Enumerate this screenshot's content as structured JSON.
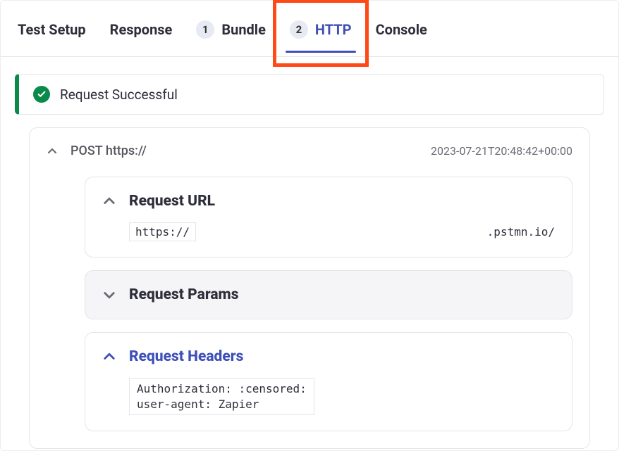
{
  "tabs": {
    "test_setup": "Test Setup",
    "response": "Response",
    "bundle": {
      "count": "1",
      "label": "Bundle"
    },
    "http": {
      "count": "2",
      "label": "HTTP"
    },
    "console": "Console"
  },
  "status": {
    "message": "Request Successful"
  },
  "request": {
    "summary": "POST https://",
    "timestamp": "2023-07-21T20:48:42+00:00",
    "sections": {
      "url": {
        "title": "Request URL",
        "prefix": "https://",
        "suffix": ".pstmn.io/"
      },
      "params": {
        "title": "Request Params"
      },
      "headers": {
        "title": "Request Headers",
        "body": "Authorization: :censored:\nuser-agent: Zapier"
      }
    }
  }
}
